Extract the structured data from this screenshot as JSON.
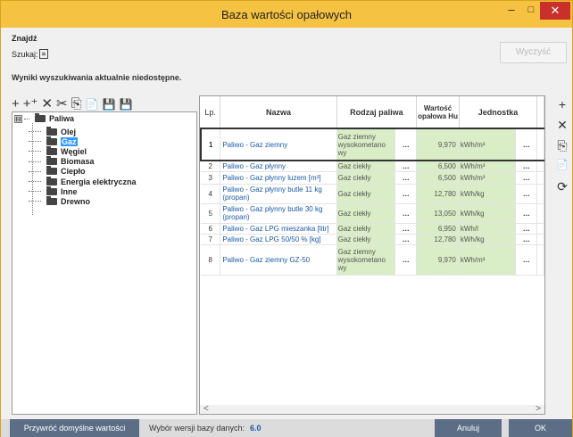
{
  "window": {
    "title": "Baza wartości opałowych",
    "min": "–",
    "max": "□",
    "close": "✕"
  },
  "search": {
    "heading": "Znajdź",
    "label": "Szukaj:",
    "clear_button": "Wyczyść",
    "results_msg": "Wyniki wyszukiwania aktualnie niedostępne."
  },
  "tree": {
    "expander": "⊟",
    "root": "Paliwa",
    "items": [
      "Olej",
      "Gaz",
      "Węgiel",
      "Biomasa",
      "Ciepło",
      "Energia elektryczna",
      "Inne",
      "Drewno"
    ]
  },
  "table": {
    "headers": [
      "Lp.",
      "Nazwa",
      "Rodzaj paliwa",
      "Wartość opałowa Hu",
      "Jednostka"
    ],
    "rows": [
      {
        "lp": "1",
        "nazwa": "Paliwo - Gaz ziemny",
        "rodzaj": "Gaz ziemny wysokometano wy",
        "wartosc": "9,970",
        "jednostka": "kWh/m³"
      },
      {
        "lp": "2",
        "nazwa": "Paliwo - Gaz płynny",
        "rodzaj": "Gaz ciekły",
        "wartosc": "6,500",
        "jednostka": "kWh/m³"
      },
      {
        "lp": "3",
        "nazwa": "Paliwo - Gaz płynny luzem [m³]",
        "rodzaj": "Gaz ciekły",
        "wartosc": "6,500",
        "jednostka": "kWh/m³"
      },
      {
        "lp": "4",
        "nazwa": "Paliwo - Gaz płynny butle  11 kg (propan)",
        "rodzaj": "Gaz ciekły",
        "wartosc": "12,780",
        "jednostka": "kWh/kg"
      },
      {
        "lp": "5",
        "nazwa": "Paliwo - Gaz płynny butle  30 kg (propan)",
        "rodzaj": "Gaz ciekły",
        "wartosc": "13,050",
        "jednostka": "kWh/kg"
      },
      {
        "lp": "6",
        "nazwa": "Paliwo - Gaz LPG mieszanka [litr]",
        "rodzaj": "Gaz ciekły",
        "wartosc": "6,950",
        "jednostka": "kWh/l"
      },
      {
        "lp": "7",
        "nazwa": "Paliwo - Gaz LPG 50/50 % [kg]",
        "rodzaj": "Gaz ciekły",
        "wartosc": "12,780",
        "jednostka": "kWh/kg"
      },
      {
        "lp": "8",
        "nazwa": "Paliwo - Gaz ziemny GZ-50",
        "rodzaj": "Gaz ziemny wysokometano wy",
        "wartosc": "9,970",
        "jednostka": "kWh/m³"
      }
    ],
    "ellipsis": "…"
  },
  "toolbar_left": {
    "add": "+",
    "add_child": "+⁺",
    "delete": "✕",
    "cut": "✂",
    "copy": "⎘",
    "paste": "📄",
    "save": "💾",
    "save_all": "💾"
  },
  "toolbar_right": {
    "add": "+",
    "delete": "✕",
    "copy": "⎘",
    "paste": "📄",
    "refresh": "⟳"
  },
  "scroll": {
    "left": "<",
    "right": ">"
  },
  "footer": {
    "restore_button": "Przywróć domyślne wartości",
    "version_label": "Wybór wersji bazy danych:",
    "version_value": "6.0",
    "cancel_button": "Anuluj",
    "ok_button": "OK"
  }
}
